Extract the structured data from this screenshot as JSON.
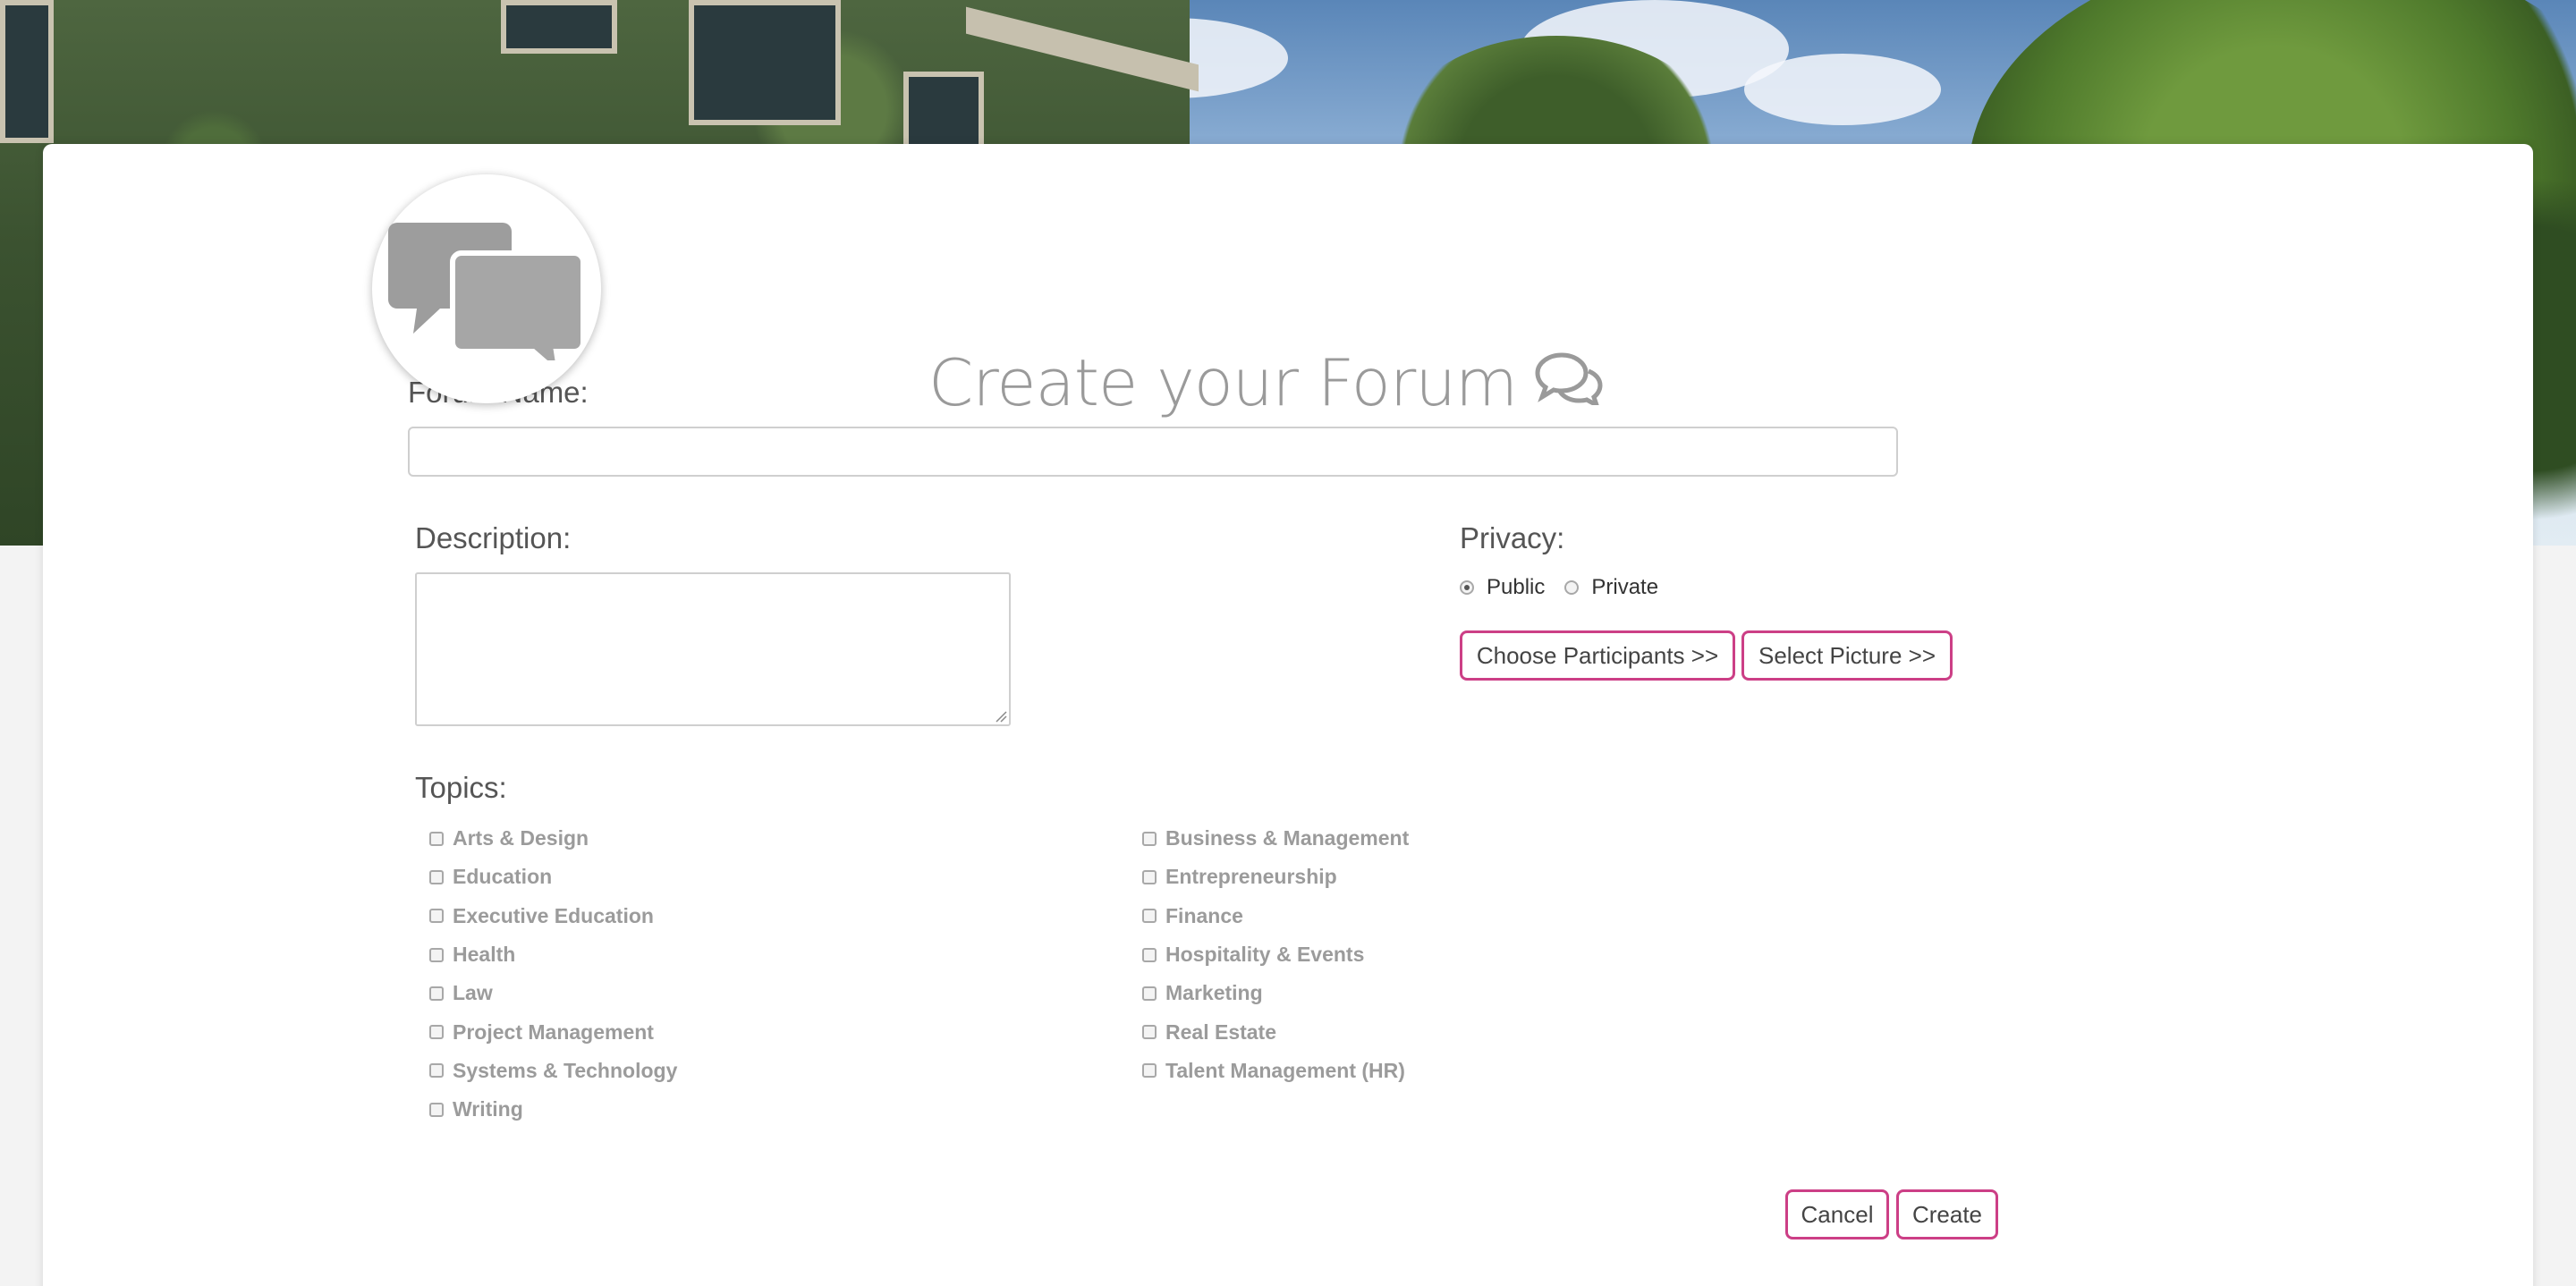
{
  "page": {
    "title": "Create your Forum",
    "title_icon": "comments-icon",
    "avatar_icon": "chat-bubbles-icon"
  },
  "form": {
    "forum_name_label": "Forum Name:",
    "forum_name_value": "",
    "description_label": "Description:",
    "description_value": "",
    "privacy_label": "Privacy:",
    "privacy_options": [
      {
        "label": "Public",
        "checked": true
      },
      {
        "label": "Private",
        "checked": false
      }
    ],
    "choose_participants_label": "Choose Participants >>",
    "select_picture_label": "Select Picture >>",
    "topics_label": "Topics:",
    "topics_left": [
      "Arts & Design",
      "Education",
      "Executive Education",
      "Health",
      "Law",
      "Project Management",
      "Systems & Technology",
      "Writing"
    ],
    "topics_right": [
      "Business & Management",
      "Entrepreneurship",
      "Finance",
      "Hospitality & Events",
      "Marketing",
      "Real Estate",
      "Talent Management (HR)"
    ],
    "cancel_label": "Cancel",
    "create_label": "Create"
  },
  "colors": {
    "accent_border": "#cc3f86",
    "title_text": "#9a9a9a",
    "topic_text": "#9b9b9b"
  }
}
